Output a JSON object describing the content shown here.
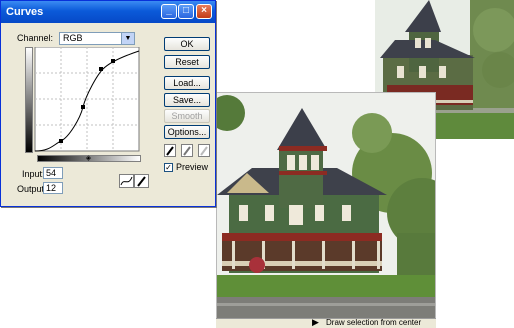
{
  "dialog": {
    "title": "Curves",
    "channel_label": "Channel:",
    "channel_value": "RGB",
    "input_label": "Input:",
    "input_value": "54",
    "output_label": "Output:",
    "output_value": "12",
    "buttons": {
      "ok": "OK",
      "reset": "Reset",
      "load": "Load...",
      "save": "Save...",
      "smooth": "Smooth",
      "options": "Options..."
    },
    "preview_label": "Preview",
    "preview_checked": true
  },
  "status_bar": {
    "text": "Draw selection from center"
  },
  "colors": {
    "titlebar": "#0b5ad9",
    "dialog_bg": "#ece9d8",
    "house_green": "#4b6b43",
    "roof_gray": "#3c3f4a"
  }
}
